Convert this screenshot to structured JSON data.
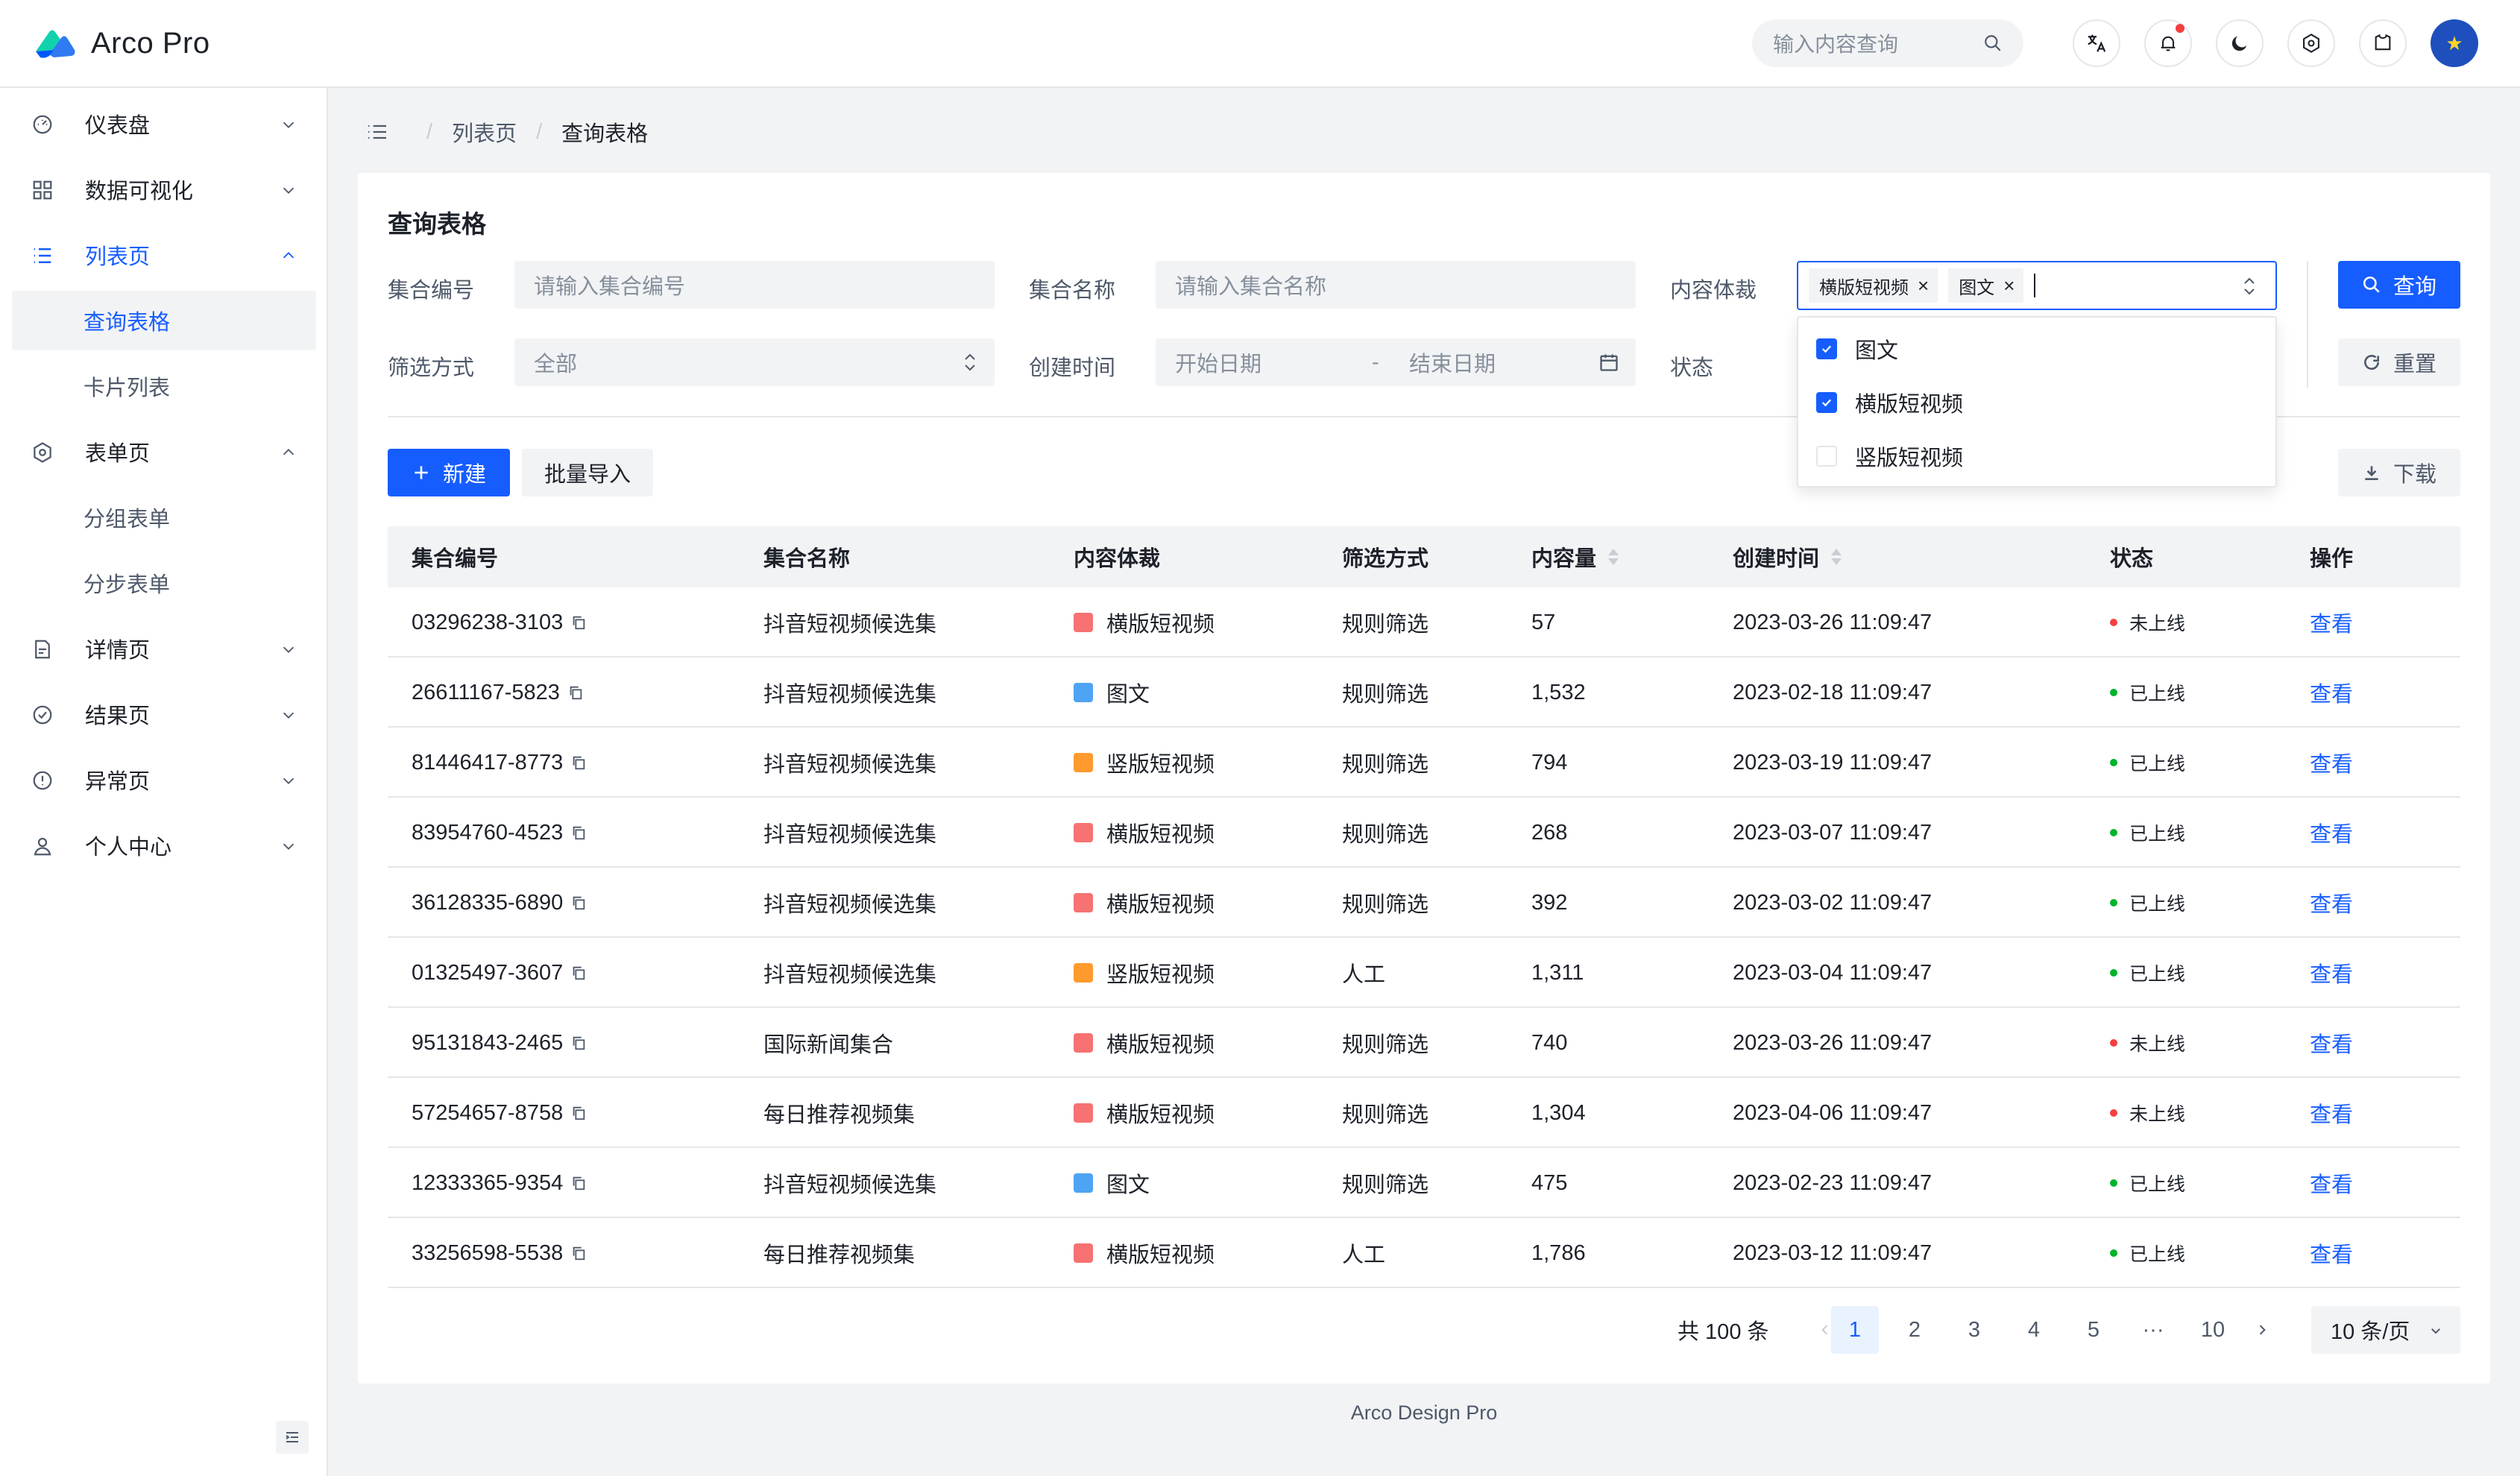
{
  "app": {
    "title": "Arco Pro",
    "search_placeholder": "输入内容查询",
    "brand_color": "#165dff"
  },
  "navbar_icons": [
    "language-icon",
    "bell-icon",
    "moon-icon",
    "gear-icon",
    "shirt-icon",
    "avatar"
  ],
  "sidebar": {
    "items": [
      {
        "label": "仪表盘",
        "icon": "dashboard-icon",
        "expanded": false
      },
      {
        "label": "数据可视化",
        "icon": "apps-icon",
        "expanded": false
      },
      {
        "label": "列表页",
        "icon": "list-icon",
        "expanded": true,
        "children": [
          {
            "label": "查询表格",
            "active": true
          },
          {
            "label": "卡片列表",
            "active": false
          }
        ]
      },
      {
        "label": "表单页",
        "icon": "settings-icon",
        "expanded": true,
        "children": [
          {
            "label": "分组表单"
          },
          {
            "label": "分步表单"
          }
        ]
      },
      {
        "label": "详情页",
        "icon": "file-icon",
        "expanded": false
      },
      {
        "label": "结果页",
        "icon": "check-circle-icon",
        "expanded": false
      },
      {
        "label": "异常页",
        "icon": "exclamation-circle-icon",
        "expanded": false
      },
      {
        "label": "个人中心",
        "icon": "user-icon",
        "expanded": false
      }
    ]
  },
  "breadcrumb": {
    "items": [
      "列表页",
      "查询表格"
    ]
  },
  "card": {
    "title": "查询表格"
  },
  "filters": {
    "id_label": "集合编号",
    "id_placeholder": "请输入集合编号",
    "name_label": "集合名称",
    "name_placeholder": "请输入集合名称",
    "type_label": "内容体裁",
    "type_tags": [
      "横版短视频",
      "图文"
    ],
    "type_options": [
      {
        "label": "图文",
        "checked": true
      },
      {
        "label": "横版短视频",
        "checked": true
      },
      {
        "label": "竖版短视频",
        "checked": false
      }
    ],
    "filter_label": "筛选方式",
    "filter_value": "全部",
    "created_label": "创建时间",
    "date_start_placeholder": "开始日期",
    "date_sep": "-",
    "date_end_placeholder": "结束日期",
    "status_label": "状态",
    "search_button": "查询",
    "reset_button": "重置"
  },
  "toolbar": {
    "new_button": "新建",
    "import_button": "批量导入",
    "download_button": "下载"
  },
  "table": {
    "columns": [
      "集合编号",
      "集合名称",
      "内容体裁",
      "筛选方式",
      "内容量",
      "创建时间",
      "状态",
      "操作"
    ],
    "rows": [
      {
        "id": "03296238-3103",
        "name": "抖音短视频候选集",
        "type": "横版短视频",
        "filter": "规则筛选",
        "count": "57",
        "created": "2023-03-26 11:09:47",
        "status": "未上线",
        "action": "查看"
      },
      {
        "id": "26611167-5823",
        "name": "抖音短视频候选集",
        "type": "图文",
        "filter": "规则筛选",
        "count": "1,532",
        "created": "2023-02-18 11:09:47",
        "status": "已上线",
        "action": "查看"
      },
      {
        "id": "81446417-8773",
        "name": "抖音短视频候选集",
        "type": "竖版短视频",
        "filter": "规则筛选",
        "count": "794",
        "created": "2023-03-19 11:09:47",
        "status": "已上线",
        "action": "查看"
      },
      {
        "id": "83954760-4523",
        "name": "抖音短视频候选集",
        "type": "横版短视频",
        "filter": "规则筛选",
        "count": "268",
        "created": "2023-03-07 11:09:47",
        "status": "已上线",
        "action": "查看"
      },
      {
        "id": "36128335-6890",
        "name": "抖音短视频候选集",
        "type": "横版短视频",
        "filter": "规则筛选",
        "count": "392",
        "created": "2023-03-02 11:09:47",
        "status": "已上线",
        "action": "查看"
      },
      {
        "id": "01325497-3607",
        "name": "抖音短视频候选集",
        "type": "竖版短视频",
        "filter": "人工",
        "count": "1,311",
        "created": "2023-03-04 11:09:47",
        "status": "已上线",
        "action": "查看"
      },
      {
        "id": "95131843-2465",
        "name": "国际新闻集合",
        "type": "横版短视频",
        "filter": "规则筛选",
        "count": "740",
        "created": "2023-03-26 11:09:47",
        "status": "未上线",
        "action": "查看"
      },
      {
        "id": "57254657-8758",
        "name": "每日推荐视频集",
        "type": "横版短视频",
        "filter": "规则筛选",
        "count": "1,304",
        "created": "2023-04-06 11:09:47",
        "status": "未上线",
        "action": "查看"
      },
      {
        "id": "12333365-9354",
        "name": "抖音短视频候选集",
        "type": "图文",
        "filter": "规则筛选",
        "count": "475",
        "created": "2023-02-23 11:09:47",
        "status": "已上线",
        "action": "查看"
      },
      {
        "id": "33256598-5538",
        "name": "每日推荐视频集",
        "type": "横版短视频",
        "filter": "人工",
        "count": "1,786",
        "created": "2023-03-12 11:09:47",
        "status": "已上线",
        "action": "查看"
      }
    ],
    "status_colors": {
      "已上线": "#00b42a",
      "未上线": "#f53f3f"
    },
    "type_colors": {
      "横版短视频": "#f77272",
      "图文": "#4ea3f4",
      "竖版短视频": "#ff9a2e"
    }
  },
  "pagination": {
    "total": "共 100 条",
    "pages": [
      "1",
      "2",
      "3",
      "4",
      "5",
      "···",
      "10"
    ],
    "current": "1",
    "page_size": "10 条/页"
  },
  "footer": "Arco Design Pro"
}
